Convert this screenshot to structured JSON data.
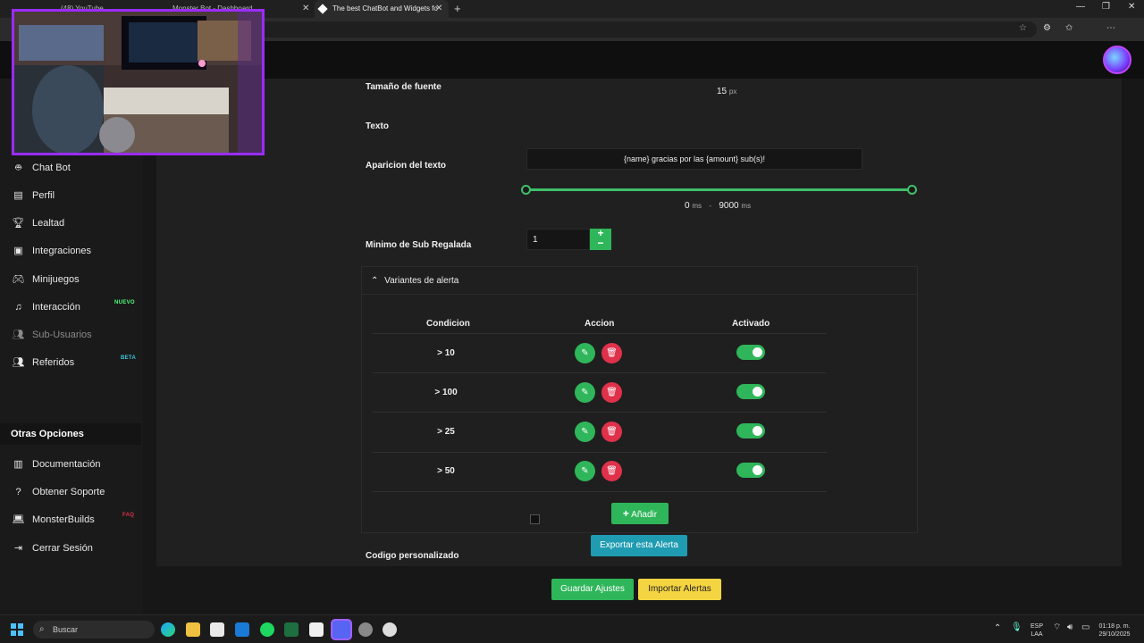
{
  "browser": {
    "tabs": [
      {
        "title": "(48) YouTube"
      },
      {
        "title": "Monster Bot - Dashboard"
      },
      {
        "title": "The best ChatBot and Widgets fo"
      }
    ],
    "new_tab_icon": "plus-icon"
  },
  "form": {
    "font_size_label": "Tamaño de fuente",
    "font_size_value": "15",
    "font_size_unit": "px",
    "text_label": "Texto",
    "text_value": "{name} gracias por las {amount} sub(s)!",
    "appearance_label": "Aparicion del texto",
    "appearance_min": "0",
    "appearance_min_unit": "ms",
    "appearance_sep": "-",
    "appearance_max": "9000",
    "appearance_max_unit": "ms",
    "min_gift_label": "Minimo de Sub Regalada",
    "min_gift_value": "1",
    "stepper_plus": "+",
    "stepper_minus": "−",
    "custom_code_label": "Codigo personalizado",
    "export_label": "Exportar esta Alerta"
  },
  "variants": {
    "header": "Variantes de alerta",
    "columns": [
      "Condicion",
      "Accion",
      "Activado"
    ],
    "rows": [
      {
        "condition": "> 10",
        "active": true
      },
      {
        "condition": "> 100",
        "active": true
      },
      {
        "condition": "> 25",
        "active": true
      },
      {
        "condition": "> 50",
        "active": true
      }
    ],
    "add_label": "Añadir"
  },
  "sidebar": {
    "items": [
      {
        "label": "Chat Bot",
        "icon": "robot-icon"
      },
      {
        "label": "Perfil",
        "icon": "id-card-icon"
      },
      {
        "label": "Lealtad",
        "icon": "trophy-icon"
      },
      {
        "label": "Integraciones",
        "icon": "plug-icon"
      },
      {
        "label": "Minijuegos",
        "icon": "gamepad-icon"
      },
      {
        "label": "Interacción",
        "icon": "music-icon",
        "badge": "NUEVO"
      },
      {
        "label": "Sub-Usuarios",
        "icon": "users-icon"
      },
      {
        "label": "Referidos",
        "icon": "user-group-icon",
        "badge": "BETA"
      }
    ],
    "section_title": "Otras Opciones",
    "other_items": [
      {
        "label": "Documentación",
        "icon": "docs-icon"
      },
      {
        "label": "Obtener Soporte",
        "icon": "question-icon"
      },
      {
        "label": "MonsterBuilds",
        "icon": "laptop-icon",
        "badge": "FAQ"
      },
      {
        "label": "Cerrar Sesión",
        "icon": "logout-icon"
      }
    ]
  },
  "footer": {
    "save_label": "Guardar Ajustes",
    "import_label": "Importar Alertas"
  },
  "taskbar": {
    "search_placeholder": "Buscar",
    "lang_top": "ESP",
    "lang_bottom": "LAA",
    "time": "01:18 p. m.",
    "date": "29/10/2025"
  },
  "colors": {
    "accent_green": "#2fb65a",
    "danger_red": "#e0314b",
    "export_teal": "#1f9cb2",
    "import_yellow": "#f5d442",
    "badge_new": "#4cff7a",
    "badge_beta": "#38c8e0",
    "badge_faq": "#e0314b",
    "webcam_border": "#9a2cff"
  }
}
